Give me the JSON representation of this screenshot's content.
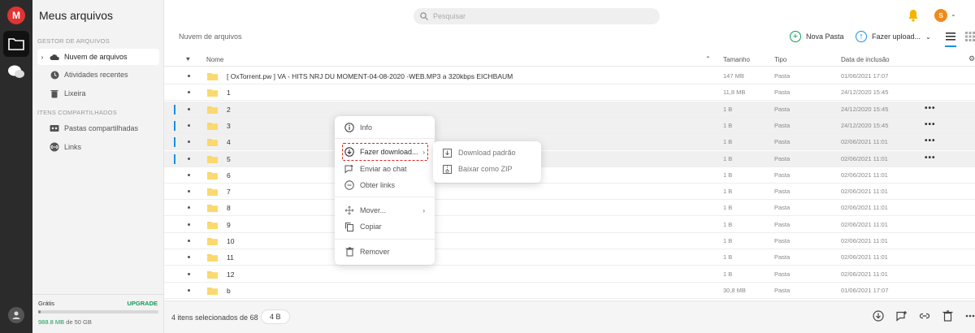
{
  "app": {
    "logo_letter": "M"
  },
  "sidebar": {
    "title": "Meus arquivos",
    "section_manager": "GESTOR DE ARQUIVOS",
    "items": [
      {
        "label": "Nuvem de arquivos",
        "icon": "cloud-icon"
      },
      {
        "label": "Atividades recentes",
        "icon": "clock-icon"
      },
      {
        "label": "Lixeira",
        "icon": "trash-icon"
      }
    ],
    "section_shared": "ITENS COMPARTILHADOS",
    "shared_items": [
      {
        "label": "Pastas compartilhadas",
        "icon": "shared-folder-icon"
      },
      {
        "label": "Links",
        "icon": "link-icon"
      }
    ],
    "storage": {
      "plan": "Grátis",
      "upgrade": "UPGRADE",
      "used": "988.8 MB",
      "total": "de 50 GB",
      "used_fraction": 0.02
    }
  },
  "topbar": {
    "search_placeholder": "Pesquisar",
    "user_initial": "S"
  },
  "toolbar": {
    "breadcrumb": "Nuvem de arquivos",
    "new_folder": "Nova Pasta",
    "upload": "Fazer upload..."
  },
  "table": {
    "headers": {
      "name": "Nome",
      "size": "Tamanho",
      "type": "Tipo",
      "date": "Data de inclusão"
    },
    "rows": [
      {
        "name": "[ OxTorrent.pw ] VA - HITS NRJ DU MOMENT-04-08-2020 -WEB.MP3 a 320kbps EICHBAUM",
        "size": "147 MB",
        "type": "Pasta",
        "date": "01/06/2021 17:07",
        "selected": false
      },
      {
        "name": "1",
        "size": "11,8 MB",
        "type": "Pasta",
        "date": "24/12/2020 15:45",
        "selected": false
      },
      {
        "name": "2",
        "size": "1 B",
        "type": "Pasta",
        "date": "24/12/2020 15:45",
        "selected": true
      },
      {
        "name": "3",
        "size": "1 B",
        "type": "Pasta",
        "date": "24/12/2020 15:45",
        "selected": true
      },
      {
        "name": "4",
        "size": "1 B",
        "type": "Pasta",
        "date": "02/06/2021 11:01",
        "selected": true
      },
      {
        "name": "5",
        "size": "1 B",
        "type": "Pasta",
        "date": "02/06/2021 11:01",
        "selected": true
      },
      {
        "name": "6",
        "size": "1 B",
        "type": "Pasta",
        "date": "02/06/2021 11:01",
        "selected": false
      },
      {
        "name": "7",
        "size": "1 B",
        "type": "Pasta",
        "date": "02/06/2021 11:01",
        "selected": false
      },
      {
        "name": "8",
        "size": "1 B",
        "type": "Pasta",
        "date": "02/06/2021 11:01",
        "selected": false
      },
      {
        "name": "9",
        "size": "1 B",
        "type": "Pasta",
        "date": "02/06/2021 11:01",
        "selected": false
      },
      {
        "name": "10",
        "size": "1 B",
        "type": "Pasta",
        "date": "02/06/2021 11:01",
        "selected": false
      },
      {
        "name": "11",
        "size": "1 B",
        "type": "Pasta",
        "date": "02/06/2021 11:01",
        "selected": false
      },
      {
        "name": "12",
        "size": "1 B",
        "type": "Pasta",
        "date": "02/06/2021 11:01",
        "selected": false
      },
      {
        "name": "b",
        "size": "30,8 MB",
        "type": "Pasta",
        "date": "01/06/2021 17:07",
        "selected": false
      }
    ]
  },
  "context_menu": {
    "info": "Info",
    "download": "Fazer download...",
    "send_chat": "Enviar ao chat",
    "get_links": "Obter links",
    "move": "Mover...",
    "copy": "Copiar",
    "remove": "Remover"
  },
  "download_submenu": {
    "standard": "Download padrão",
    "zip": "Baixar como ZIP"
  },
  "bottombar": {
    "selection_info": "4 itens selecionados de 68",
    "selection_size": "4 B"
  },
  "colors": {
    "accent_blue": "#1c8fe3",
    "accent_green": "#0f9d58",
    "brand_red": "#e13333",
    "folder_yellow": "#f7d66b",
    "highlight_red": "#e02424"
  }
}
